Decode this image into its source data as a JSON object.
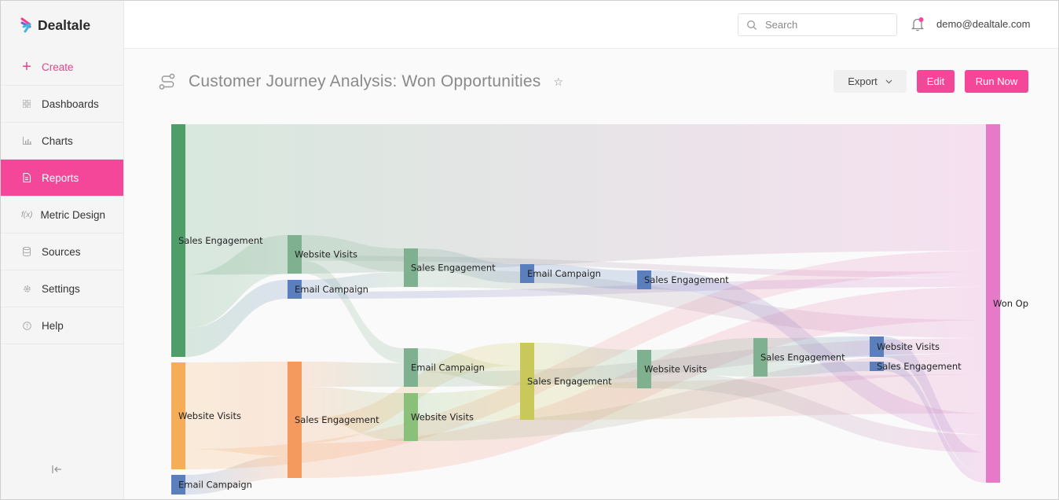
{
  "app": {
    "name": "Dealtale"
  },
  "sidebar": {
    "items": [
      {
        "label": "Create",
        "icon": "plus-icon"
      },
      {
        "label": "Dashboards",
        "icon": "grid-icon"
      },
      {
        "label": "Charts",
        "icon": "bar-chart-icon"
      },
      {
        "label": "Reports",
        "icon": "document-icon"
      },
      {
        "label": "Metric Design",
        "icon": "function-icon"
      },
      {
        "label": "Sources",
        "icon": "database-icon"
      },
      {
        "label": "Settings",
        "icon": "gear-icon"
      },
      {
        "label": "Help",
        "icon": "help-icon"
      }
    ],
    "active_item": "Reports"
  },
  "topbar": {
    "search_placeholder": "Search",
    "user_email": "demo@dealtale.com"
  },
  "page": {
    "title": "Customer Journey Analysis: Won Opportunities",
    "export_label": "Export",
    "edit_label": "Edit",
    "run_label": "Run Now"
  },
  "colors": {
    "accent": "#f5479a",
    "sales_engagement": "#4f9e6a",
    "website_visits": "#f6ad58",
    "email_campaign": "#5b7fbd",
    "won": "#e67ac9"
  },
  "chart_data": {
    "type": "sankey",
    "nodes": [
      {
        "id": "s0",
        "label": "Sales Engagement",
        "stage": 0,
        "color": "#4f9e6a"
      },
      {
        "id": "w0",
        "label": "Website Visits",
        "stage": 0,
        "color": "#f6ad58"
      },
      {
        "id": "e0",
        "label": "Email Campaign",
        "stage": 0,
        "color": "#5b7fbd"
      },
      {
        "id": "w1",
        "label": "Website Visits",
        "stage": 1,
        "color": "#7fb08f"
      },
      {
        "id": "e1",
        "label": "Email Campaign",
        "stage": 1,
        "color": "#5b7fbd"
      },
      {
        "id": "s1",
        "label": "Sales Engagement",
        "stage": 1,
        "color": "#f49a5e"
      },
      {
        "id": "s2",
        "label": "Sales Engagement",
        "stage": 2,
        "color": "#7fb08f"
      },
      {
        "id": "e2",
        "label": "Email Campaign",
        "stage": 2,
        "color": "#7fb08f"
      },
      {
        "id": "w2",
        "label": "Website Visits",
        "stage": 2,
        "color": "#8bc07a"
      },
      {
        "id": "e3",
        "label": "Email Campaign",
        "stage": 3,
        "color": "#5b7fbd"
      },
      {
        "id": "s3",
        "label": "Sales Engagement",
        "stage": 3,
        "color": "#c9c85a"
      },
      {
        "id": "s4",
        "label": "Sales Engagement",
        "stage": 4,
        "color": "#5b7fbd"
      },
      {
        "id": "w4",
        "label": "Website Visits",
        "stage": 4,
        "color": "#7fb08f"
      },
      {
        "id": "s5",
        "label": "Sales Engagement",
        "stage": 5,
        "color": "#7fb08f"
      },
      {
        "id": "w6",
        "label": "Website Visits",
        "stage": 6,
        "color": "#5b7fbd"
      },
      {
        "id": "s6",
        "label": "Sales Engagement",
        "stage": 6,
        "color": "#5b7fbd"
      },
      {
        "id": "won",
        "label": "Won Opportunities",
        "stage": 7,
        "color": "#e67ac9"
      }
    ],
    "links": [
      {
        "source": "s0",
        "target": "won",
        "value": 42
      },
      {
        "source": "s0",
        "target": "w1",
        "value": 15
      },
      {
        "source": "s0",
        "target": "e1",
        "value": 8
      },
      {
        "source": "w0",
        "target": "s1",
        "value": 30
      },
      {
        "source": "w0",
        "target": "won",
        "value": 7
      },
      {
        "source": "e0",
        "target": "s1",
        "value": 7
      },
      {
        "source": "w1",
        "target": "s2",
        "value": 8
      },
      {
        "source": "w1",
        "target": "won",
        "value": 2
      },
      {
        "source": "w1",
        "target": "e2",
        "value": 5
      },
      {
        "source": "e1",
        "target": "s2",
        "value": 5
      },
      {
        "source": "e1",
        "target": "won",
        "value": 3
      },
      {
        "source": "s1",
        "target": "e2",
        "value": 8
      },
      {
        "source": "s1",
        "target": "w2",
        "value": 10
      },
      {
        "source": "s1",
        "target": "s3",
        "value": 8
      },
      {
        "source": "s1",
        "target": "won",
        "value": 11
      },
      {
        "source": "s2",
        "target": "e3",
        "value": 7
      },
      {
        "source": "s2",
        "target": "won",
        "value": 6
      },
      {
        "source": "e2",
        "target": "s3",
        "value": 8
      },
      {
        "source": "e2",
        "target": "won",
        "value": 5
      },
      {
        "source": "w2",
        "target": "s3",
        "value": 11
      },
      {
        "source": "w2",
        "target": "won",
        "value": 7
      },
      {
        "source": "e3",
        "target": "s4",
        "value": 7
      },
      {
        "source": "s3",
        "target": "w4",
        "value": 14
      },
      {
        "source": "s3",
        "target": "won",
        "value": 13
      },
      {
        "source": "s4",
        "target": "won",
        "value": 7
      },
      {
        "source": "w4",
        "target": "s5",
        "value": 8
      },
      {
        "source": "w4",
        "target": "won",
        "value": 6
      },
      {
        "source": "s5",
        "target": "w6",
        "value": 7
      },
      {
        "source": "s5",
        "target": "s6",
        "value": 3
      },
      {
        "source": "w6",
        "target": "won",
        "value": 7
      },
      {
        "source": "s6",
        "target": "won",
        "value": 3
      }
    ]
  }
}
